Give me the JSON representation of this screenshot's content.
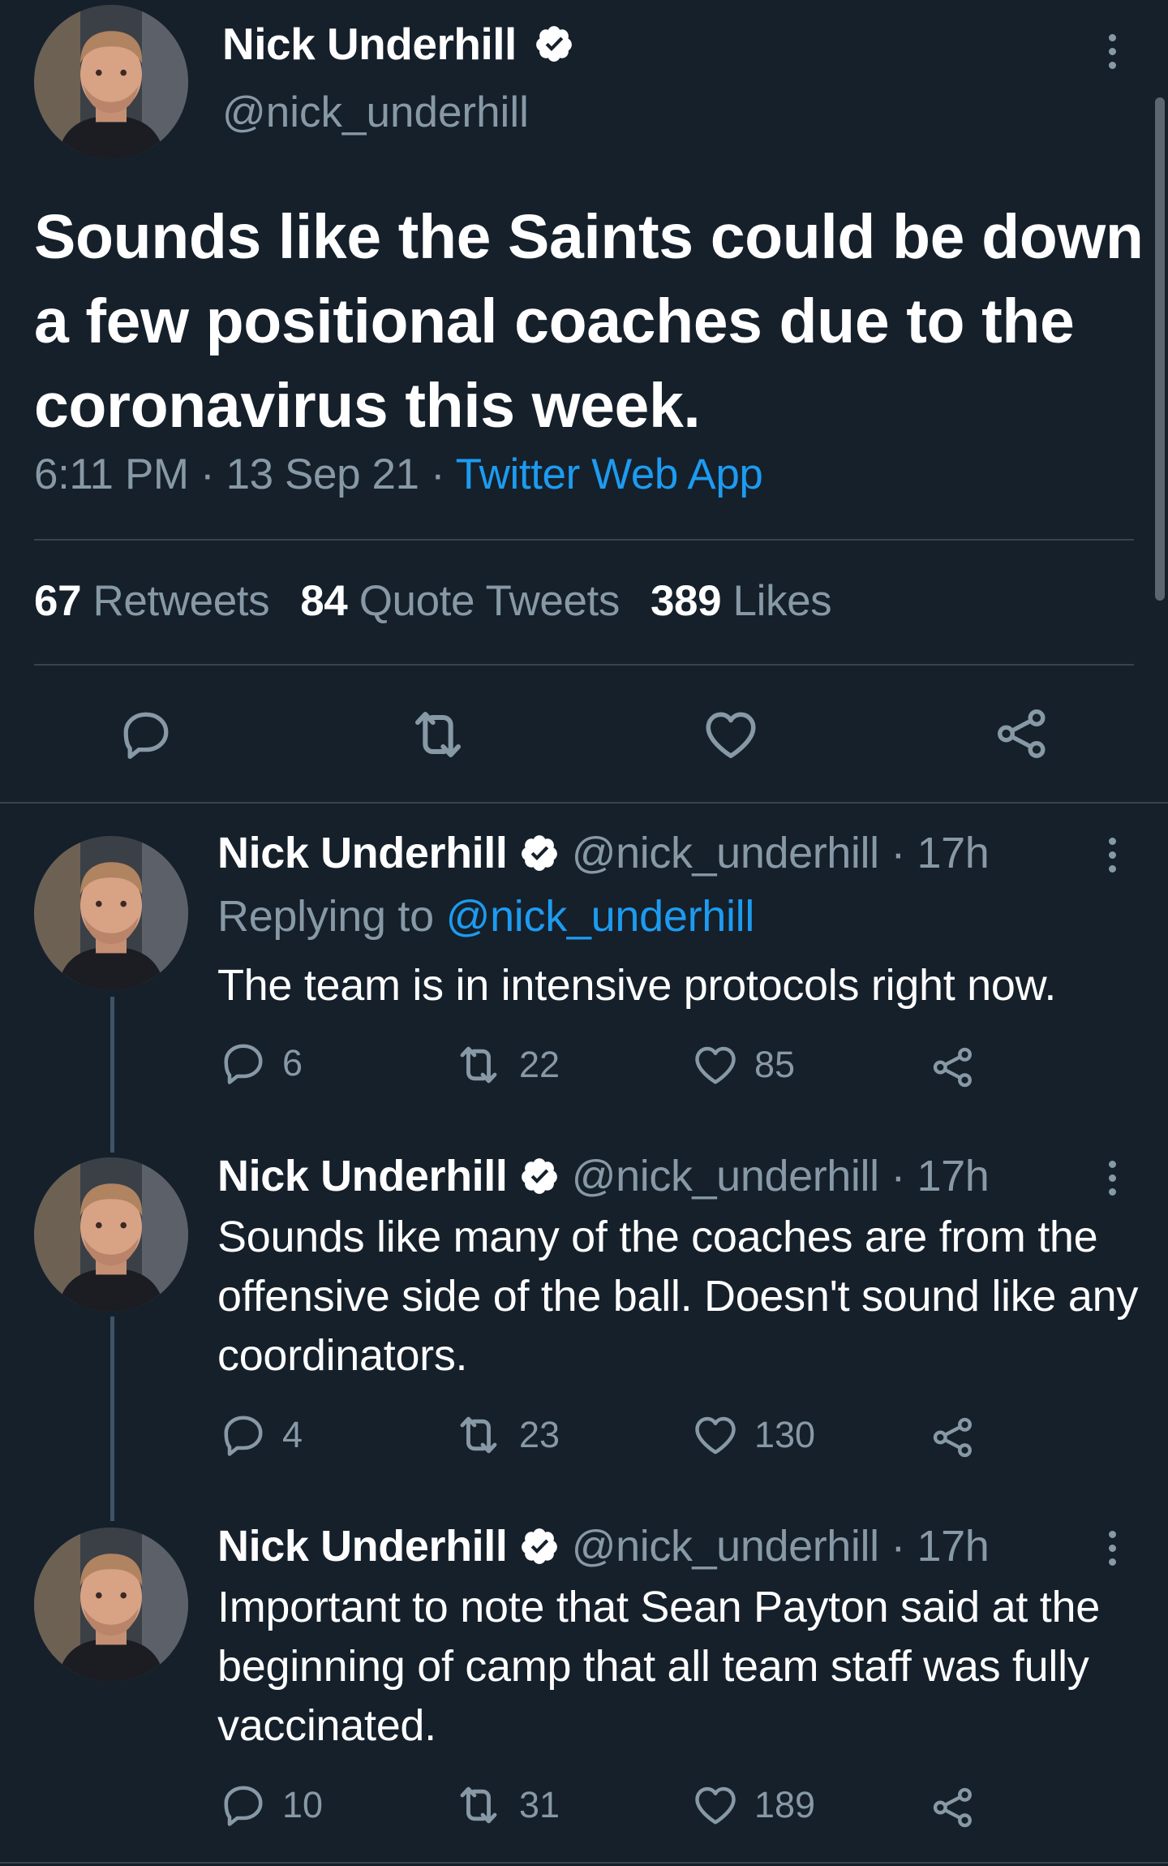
{
  "main_tweet": {
    "author_name": "Nick Underhill",
    "handle": "@nick_underhill",
    "text": "Sounds like the Saints could be down a few positional coaches due to the coronavirus this week.",
    "time": "6:11 PM",
    "date": "13 Sep 21",
    "source": "Twitter Web App",
    "separator": " · ",
    "stats": {
      "retweets_count": "67",
      "retweets_label": "Retweets",
      "quotes_count": "84",
      "quotes_label": "Quote Tweets",
      "likes_count": "389",
      "likes_label": "Likes"
    }
  },
  "replies": [
    {
      "author_name": "Nick Underhill",
      "handle": "@nick_underhill",
      "time_ago": "· 17h",
      "replying_prefix": "Replying to ",
      "replying_to": "@nick_underhill",
      "text": "The team is in intensive protocols right now.",
      "reply_count": "6",
      "retweet_count": "22",
      "like_count": "85"
    },
    {
      "author_name": "Nick Underhill",
      "handle": "@nick_underhill",
      "time_ago": "· 17h",
      "text": "Sounds like many of the coaches are from the offensive side of the ball. Doesn't sound like any coordinators.",
      "reply_count": "4",
      "retweet_count": "23",
      "like_count": "130"
    },
    {
      "author_name": "Nick Underhill",
      "handle": "@nick_underhill",
      "time_ago": "· 17h",
      "text": "Important to note that Sean Payton said at the beginning of camp that all team staff was fully vaccinated.",
      "reply_count": "10",
      "retweet_count": "31",
      "like_count": "189"
    }
  ],
  "colors": {
    "background": "#15202b",
    "muted": "#8899a6",
    "link": "#1d9bf0",
    "divider": "#38444d"
  }
}
